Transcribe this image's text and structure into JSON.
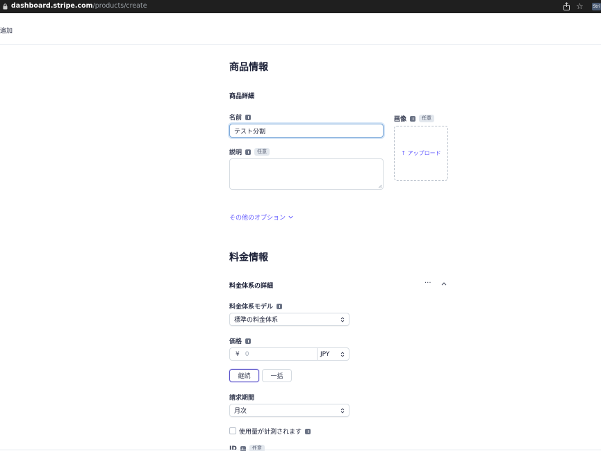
{
  "browser": {
    "url_domain": "dashboard.stripe.com",
    "url_path": "/products/create",
    "ext_label": "Stri"
  },
  "header": {
    "title": "追加"
  },
  "product_info": {
    "section_title": "商品情報",
    "subsection_title": "商品詳細",
    "name_label": "名前",
    "name_value": "テスト分割",
    "description_label": "説明",
    "optional_badge": "任意",
    "image_label": "画像",
    "upload_label": "↑ アップロード",
    "more_options_link": "その他のオプション"
  },
  "pricing": {
    "section_title": "料金情報",
    "subsection_title": "料金体系の詳細",
    "more_menu": "···",
    "model_label": "料金体系モデル",
    "model_value": "標準の料金体系",
    "price_label": "価格",
    "currency_symbol": "¥",
    "price_placeholder": "0",
    "currency_value": "JPY",
    "recurring_button": "継続",
    "one_time_button": "一括",
    "billing_period_label": "請求期間",
    "billing_period_value": "月次",
    "metered_label": "使用量が計測されます",
    "id_label": "ID"
  },
  "colors": {
    "accent": "#635bff",
    "focus_ring": "#7aa7d8",
    "text": "#1a1f36"
  }
}
